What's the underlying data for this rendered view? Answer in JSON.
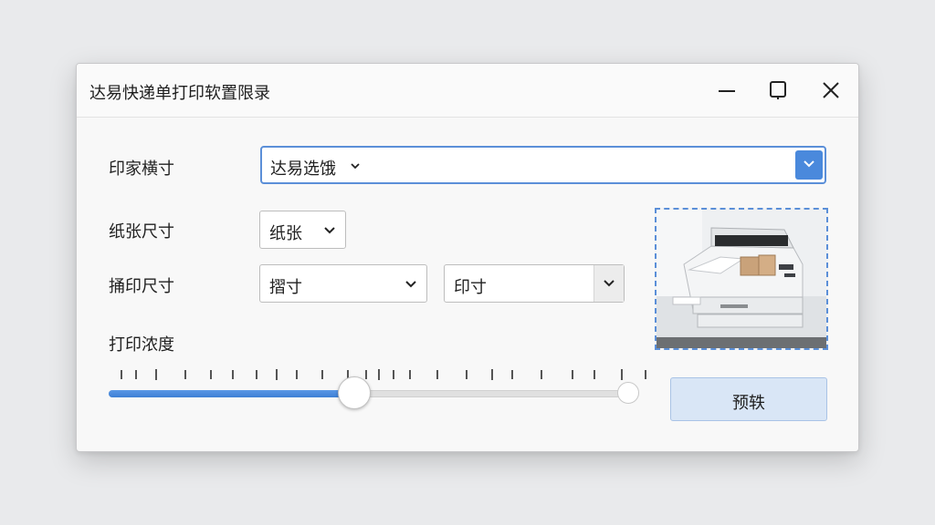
{
  "window": {
    "title": "达易快递单打印软置限录"
  },
  "form": {
    "template_label": "印家横寸",
    "template_value": "达易选饿",
    "paper_label": "纸张尺寸",
    "paper_value": "纸张",
    "print_size_label": "捅印尺寸",
    "print_size_value1": "摺寸",
    "print_size_value2": "印寸",
    "density_label": "打印浓度",
    "density_level": 0.5
  },
  "buttons": {
    "preview_label": "预轶"
  },
  "colors": {
    "accent": "#4a89dc",
    "button_bg": "#d9e6f6"
  },
  "icons": {
    "minimize": "minimize-icon",
    "maximize": "maximize-icon",
    "close": "close-icon",
    "dropdown": "chevron-down-icon"
  }
}
